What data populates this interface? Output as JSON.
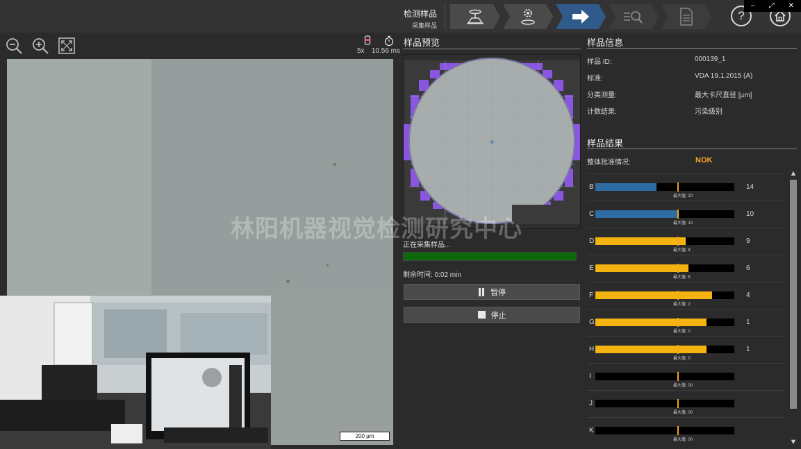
{
  "header": {
    "step_title": "检测样品",
    "step_subtitle": "采集样品",
    "steps": [
      {
        "icon": "sample-holder-icon",
        "state": "done"
      },
      {
        "icon": "gear-icon",
        "state": "done"
      },
      {
        "icon": "arrow-right-icon",
        "state": "active"
      },
      {
        "icon": "magnifier-icon",
        "state": "pending"
      },
      {
        "icon": "document-icon",
        "state": "pending"
      }
    ],
    "help_label": "?",
    "home_icon": "home-icon"
  },
  "window_controls": {
    "minimize": "–",
    "restore": "⤢",
    "close": "✕"
  },
  "image_view": {
    "objective": "5x",
    "exposure": "10.56 ms",
    "scale_label": "200 µm"
  },
  "preview": {
    "title": "样品预览",
    "status": "正在采集样品...",
    "progress": 1.0,
    "progress_color": "#0a6a0a",
    "remaining": "剩余时间: 0:02 min",
    "pause_label": "暂停",
    "stop_label": "停止"
  },
  "sample_info": {
    "title": "样品信息",
    "rows": [
      {
        "label": "样品 ID:",
        "value": "000139_1"
      },
      {
        "label": "标准:",
        "value": "VDA 19.1.2015 (A)"
      },
      {
        "label": "分类测量:",
        "value": "最大卡尺直径 [µm]"
      },
      {
        "label": "计数结果:",
        "value": "污染级别"
      }
    ]
  },
  "sample_results": {
    "title": "样品结果",
    "overall_label": "整体批准情况:",
    "overall_value": "NOK",
    "overall_color": "#f5a623",
    "rows": [
      {
        "class": "B",
        "fill": 0.44,
        "limit": 0.59,
        "color": "#2e6da4",
        "max_label": "最大值: 20",
        "count": "14"
      },
      {
        "class": "C",
        "fill": 0.59,
        "limit": 0.59,
        "color": "#2e6da4",
        "max_label": "最大值: 10",
        "count": "10"
      },
      {
        "class": "D",
        "fill": 0.65,
        "limit": 0.59,
        "color": "#f5b30f",
        "max_label": "最大值: 8",
        "count": "9"
      },
      {
        "class": "E",
        "fill": 0.67,
        "limit": 0.59,
        "color": "#f5b30f",
        "max_label": "最大值: 5",
        "count": "6"
      },
      {
        "class": "F",
        "fill": 0.84,
        "limit": 0.59,
        "color": "#f5b30f",
        "max_label": "最大值: 2",
        "count": "4"
      },
      {
        "class": "G",
        "fill": 0.8,
        "limit": 0.59,
        "color": "#f5b30f",
        "max_label": "最大值: 0",
        "count": "1"
      },
      {
        "class": "H",
        "fill": 0.8,
        "limit": 0.59,
        "color": "#f5b30f",
        "max_label": "最大值: 0",
        "count": "1"
      },
      {
        "class": "I",
        "fill": 0,
        "limit": 0.59,
        "color": "#f5b30f",
        "max_label": "最大值: 00",
        "count": ""
      },
      {
        "class": "J",
        "fill": 0,
        "limit": 0.59,
        "color": "#f5b30f",
        "max_label": "最大值: 00",
        "count": ""
      },
      {
        "class": "K",
        "fill": 0,
        "limit": 0.59,
        "color": "#f5b30f",
        "max_label": "最大值: 00",
        "count": ""
      }
    ]
  },
  "watermark": "林阳机器视觉检测研究中心"
}
